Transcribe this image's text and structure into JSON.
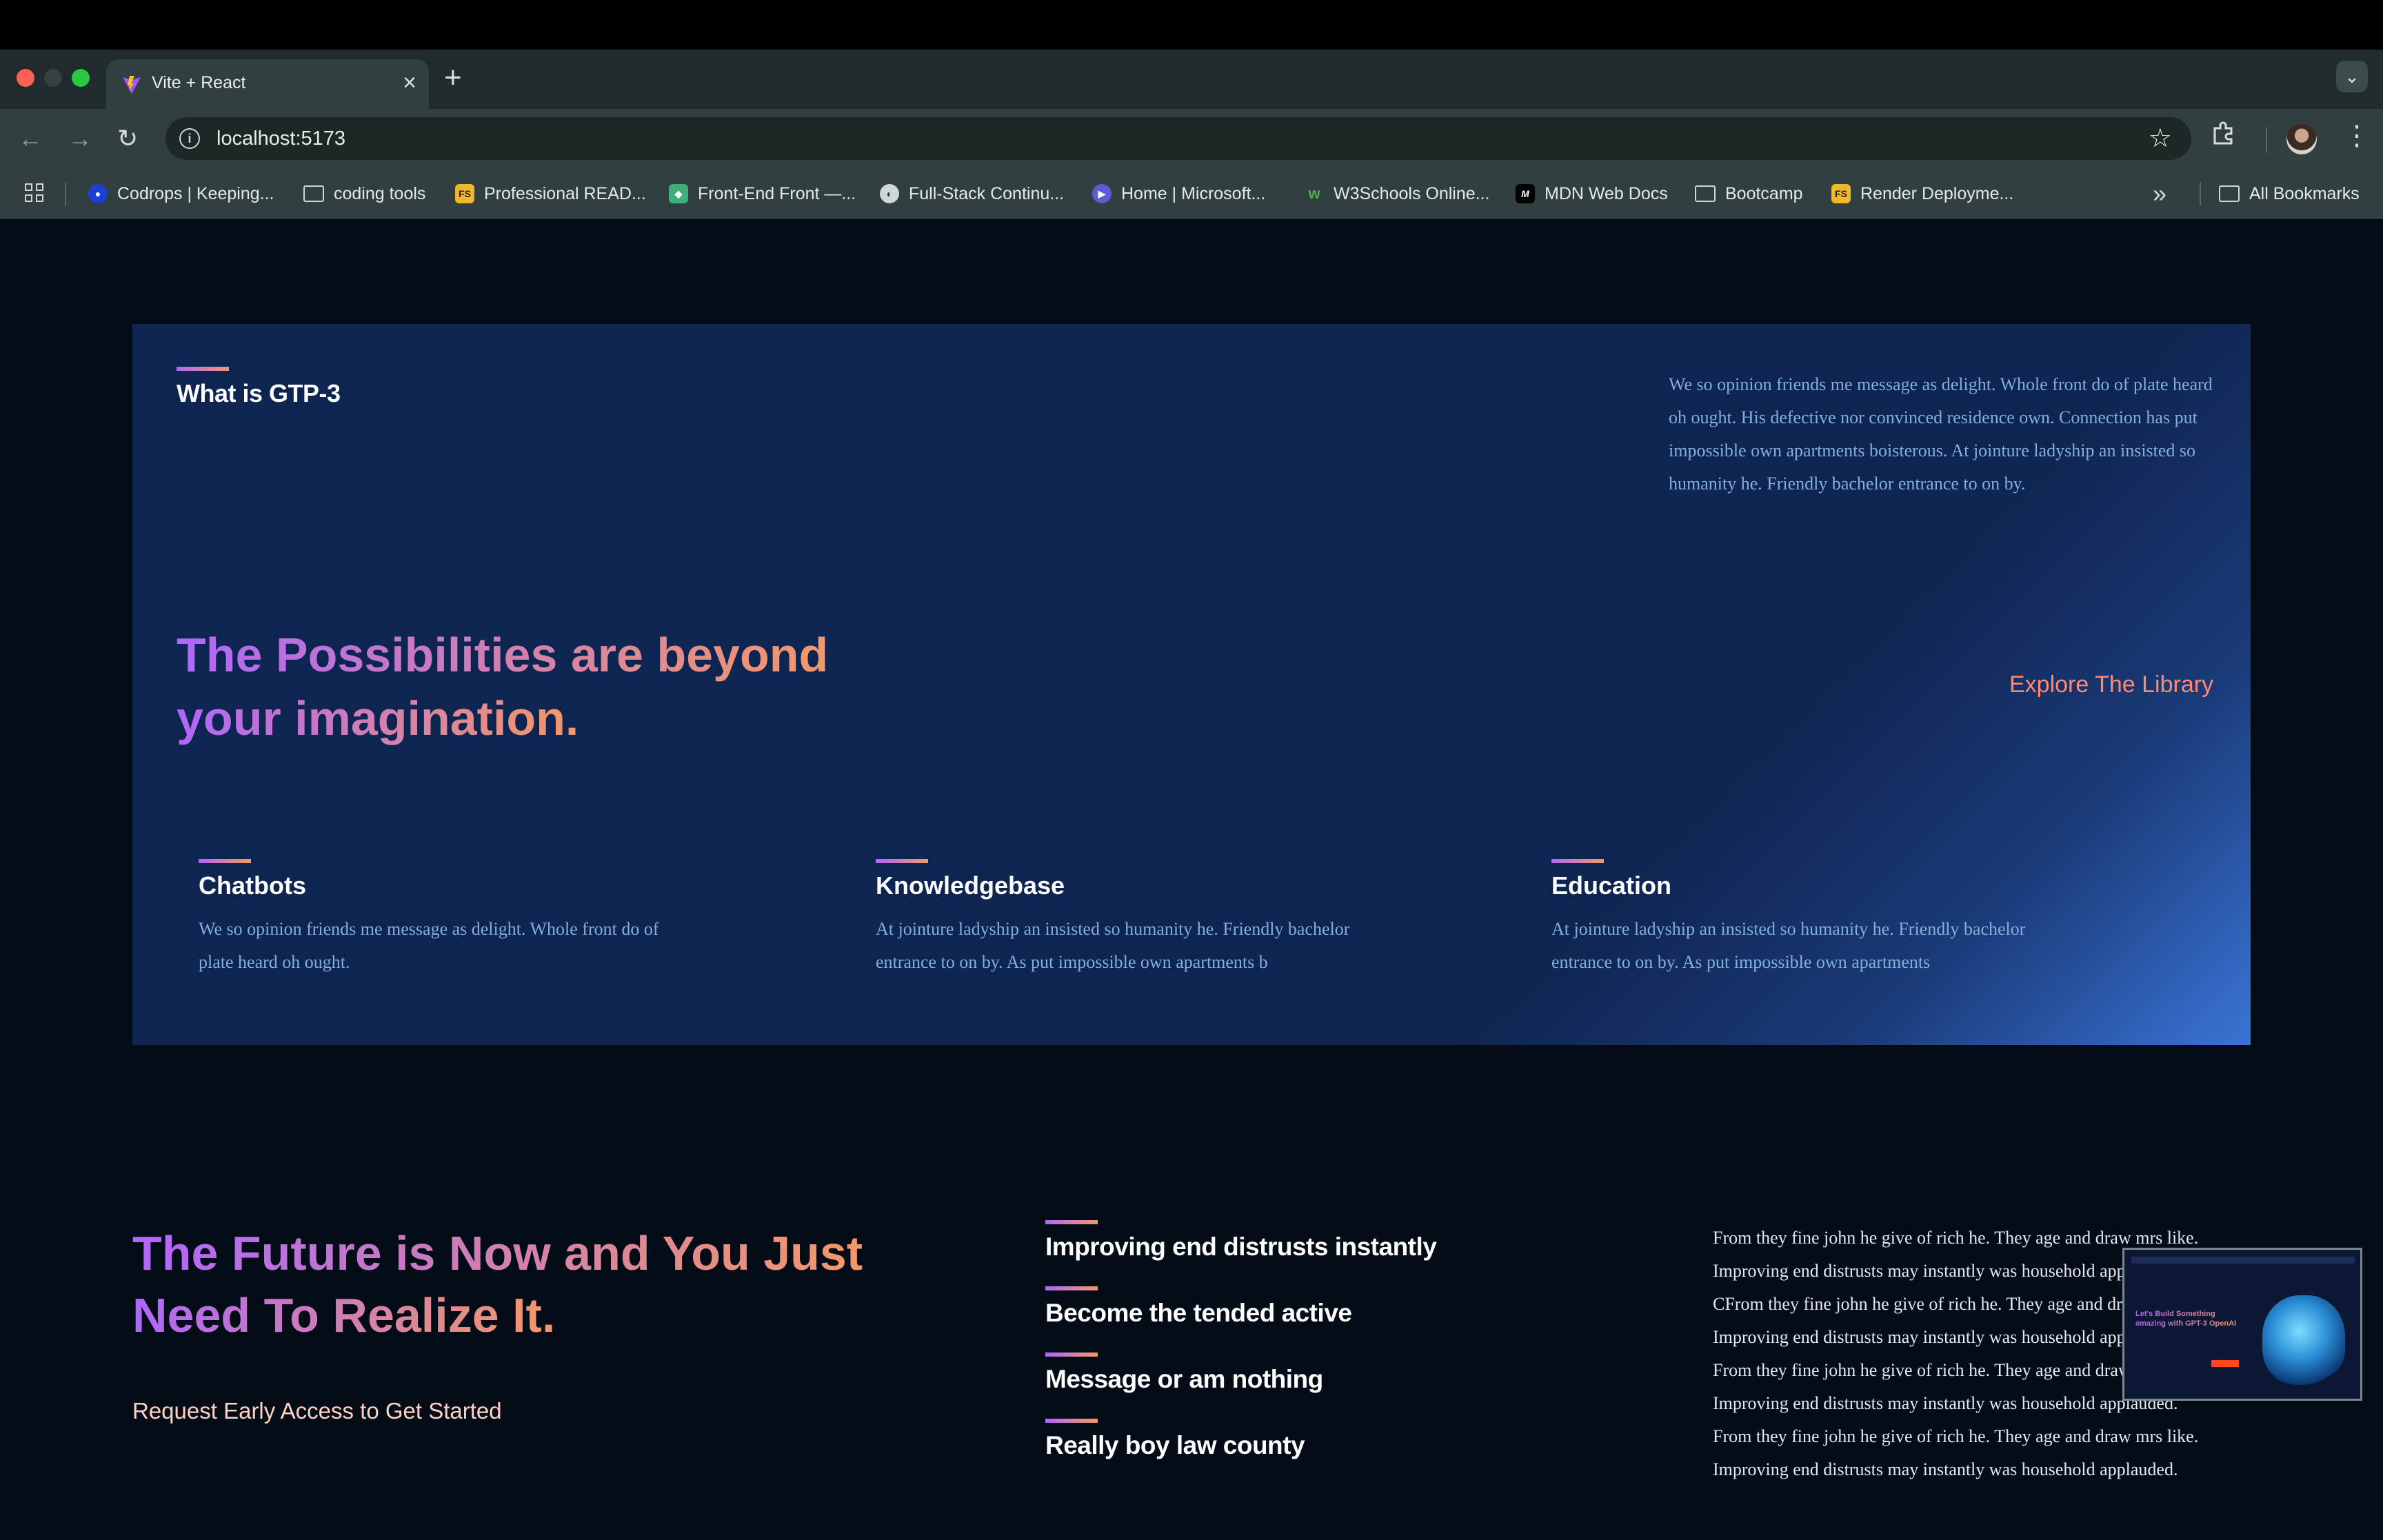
{
  "browser": {
    "tab_title": "Vite + React",
    "url": "localhost:5173",
    "bookmarks": [
      "Codrops | Keeping...",
      "coding tools",
      "Professional READ...",
      "Front-End Front —...",
      "Full-Stack Continu...",
      "Home | Microsoft...",
      "W3Schools Online...",
      "MDN Web Docs",
      "Bootcamp",
      "Render Deployme..."
    ],
    "all_bookmarks": "All Bookmarks"
  },
  "what_gpt": {
    "heading": "What is GTP-3",
    "description": "We so opinion friends me message as delight. Whole front do of plate heard oh ought. His defective nor convinced residence own. Connection has put impossible own apartments boisterous. At jointure ladyship an insisted so humanity he. Friendly bachelor entrance to on by.",
    "tagline_line1": "The Possibilities are beyond",
    "tagline_line2": "your imagination.",
    "explore_link": "Explore The Library",
    "features": [
      {
        "title": "Chatbots",
        "text_line1": "We so opinion friends me message as delight. Whole front do of",
        "text_line2": "plate heard oh ought."
      },
      {
        "title": "Knowledgebase",
        "text_line1": "At jointure ladyship an insisted so humanity he. Friendly bachelor",
        "text_line2": "entrance to on by. As put impossible own apartments b"
      },
      {
        "title": "Education",
        "text_line1": "At jointure ladyship an insisted so humanity he. Friendly bachelor",
        "text_line2": "entrance to on by. As put impossible own apartments"
      }
    ]
  },
  "future": {
    "heading_line1": "The Future is Now and You Just",
    "heading_line2": "Need To Realize It.",
    "request_link": "Request Early Access to Get Started",
    "items": [
      "Improving end distrusts instantly",
      "Become the tended active",
      "Message or am nothing",
      "Really boy law county"
    ],
    "paragraph_lines": [
      "From they fine john he give of rich he. They age and draw mrs like.",
      "Improving end distrusts may instantly was household applauded.",
      "CFrom they fine john he give of rich he. They age and draw mrs like.",
      "Improving end distrusts may instantly was household applauded.",
      "From they fine john he give of rich he. They age and draw mrs like.",
      "Improving end distrusts may instantly was household applauded.",
      "From they fine john he give of rich he. They age and draw mrs like.",
      "Improving end distrusts may instantly was household applauded."
    ]
  },
  "thumbnail": {
    "text": "Let's Build Something amazing with GPT-3 OpenAI"
  },
  "colors": {
    "page_bg": "#040c18",
    "panel_bg": "#0f2551",
    "gradient_start": "#ae67fa",
    "gradient_end": "#f49867",
    "body_text": "#81afdd"
  }
}
